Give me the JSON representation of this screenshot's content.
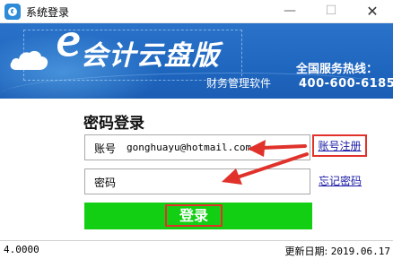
{
  "window": {
    "title": "系统登录",
    "minimize_glyph": "—",
    "maximize_glyph": "☐",
    "close_glyph": "✕"
  },
  "banner": {
    "logo_text": "会计云盘版",
    "subtitle": "财务管理软件",
    "hotline_label": "全国服务热线：",
    "hotline_number": "400-600-6185",
    "colors": {
      "background": "#1f66bf",
      "text": "#ffffff"
    }
  },
  "login": {
    "heading": "密码登录",
    "account_label": "账号",
    "account_value": "gonghuayu@hotmail.com",
    "password_label": "密码",
    "password_value": "",
    "register_link": "账号注册",
    "forgot_link": "忘记密码",
    "submit_label": "登录",
    "colors": {
      "submit_bg": "#13cf13",
      "highlight": "#e0322a",
      "link": "#1a1aa6"
    }
  },
  "status": {
    "version": "4.0000",
    "update_label": "更新日期:",
    "update_date": "2019.06.17"
  },
  "icons": [
    "app-icon",
    "cloud-icon",
    "logo-e-icon",
    "arrow-icon"
  ]
}
